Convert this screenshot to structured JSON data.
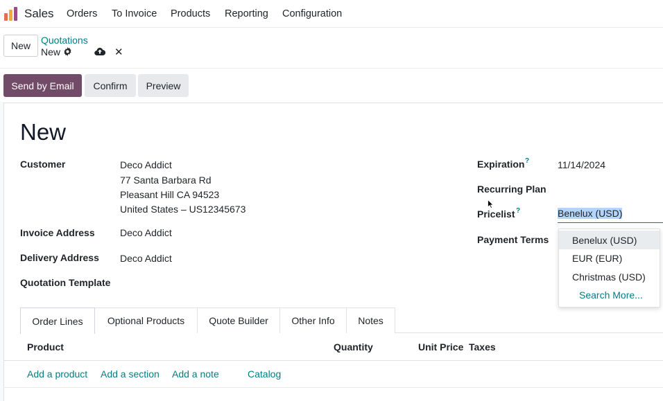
{
  "nav": {
    "app_name": "Sales",
    "menu": [
      "Orders",
      "To Invoice",
      "Products",
      "Reporting",
      "Configuration"
    ]
  },
  "control_panel": {
    "new_button": "New",
    "breadcrumb": "Quotations",
    "record_name": "New"
  },
  "status_bar": {
    "send_by_email": "Send by Email",
    "confirm": "Confirm",
    "preview": "Preview"
  },
  "form": {
    "title": "New",
    "customer_label": "Customer",
    "customer_name": "Deco Addict",
    "customer_address_1": "77 Santa Barbara Rd",
    "customer_address_2": "Pleasant Hill CA 94523",
    "customer_address_3": "United States – US12345673",
    "invoice_address_label": "Invoice Address",
    "invoice_address_value": "Deco Addict",
    "delivery_address_label": "Delivery Address",
    "delivery_address_value": "Deco Addict",
    "quotation_template_label": "Quotation Template",
    "expiration_label": "Expiration",
    "expiration_value": "11/14/2024",
    "recurring_plan_label": "Recurring Plan",
    "pricelist_label": "Pricelist",
    "pricelist_value": "Benelux (USD)",
    "payment_terms_label": "Payment Terms",
    "help_marker": "?"
  },
  "pricelist_dropdown": {
    "options": [
      "Benelux (USD)",
      "EUR (EUR)",
      "Christmas (USD)"
    ],
    "search_more": "Search More..."
  },
  "tabs": [
    "Order Lines",
    "Optional Products",
    "Quote Builder",
    "Other Info",
    "Notes"
  ],
  "order_lines": {
    "columns": [
      "Product",
      "Quantity",
      "Unit Price",
      "Taxes"
    ],
    "add_product": "Add a product",
    "add_section": "Add a section",
    "add_note": "Add a note",
    "catalog": "Catalog"
  },
  "colors": {
    "primary": "#714b67",
    "link": "#017e84",
    "selection": "#b3d4fc"
  }
}
